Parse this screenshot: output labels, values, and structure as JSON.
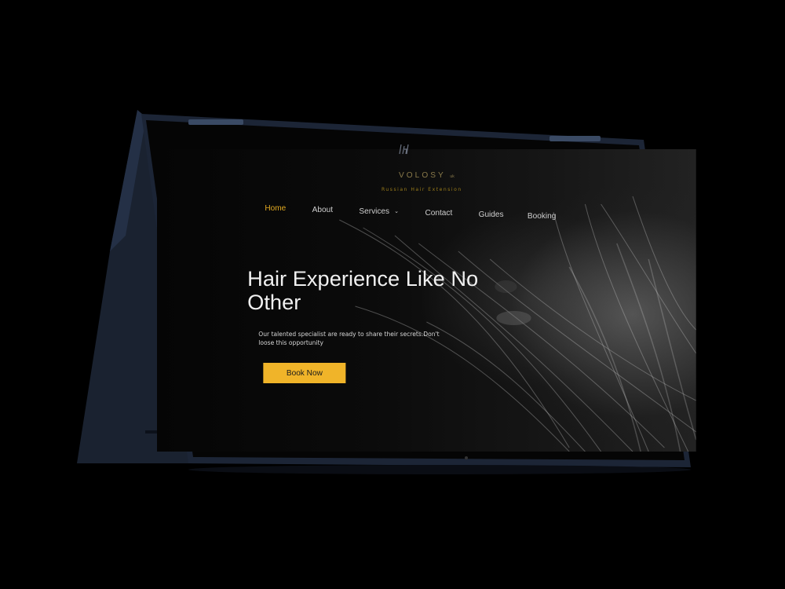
{
  "site": {
    "brand": "VOLOSY",
    "brand_suffix": "uk",
    "tagline": "Russian Hair Extension"
  },
  "nav": {
    "items": [
      {
        "label": "Home",
        "active": true
      },
      {
        "label": "About",
        "active": false
      },
      {
        "label": "Services",
        "active": false,
        "has_dropdown": true
      },
      {
        "label": "Contact",
        "active": false
      },
      {
        "label": "Guides",
        "active": false
      },
      {
        "label": "Booking",
        "active": false
      }
    ]
  },
  "hero": {
    "title": "Hair Experience Like No Other",
    "subtitle": "Our talented specialist are ready to share their secrets.Don't loose this opportunity",
    "cta_label": "Book Now"
  },
  "colors": {
    "accent": "#f0b429",
    "nav_active": "#e0a820",
    "device_frame": "#1c2536",
    "page_bg": "#000000"
  },
  "icons": {
    "device_logo": "hp-logo-icon",
    "dropdown": "chevron-down-icon",
    "camera": "camera-icon"
  }
}
